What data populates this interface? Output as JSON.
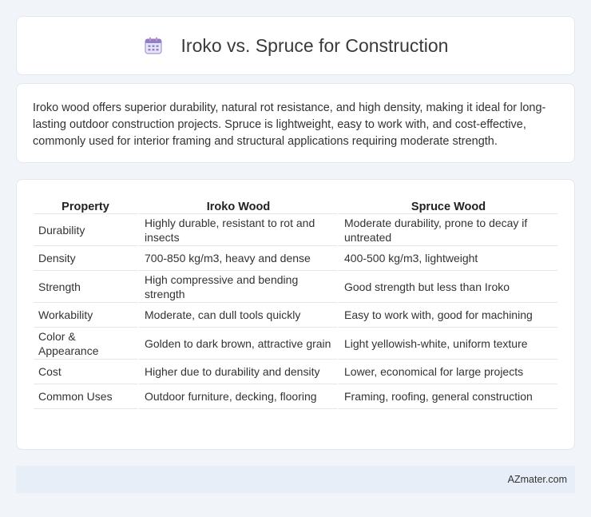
{
  "header": {
    "title": "Iroko vs. Spruce for Construction",
    "icon": "calendar-icon"
  },
  "intro": {
    "text": "Iroko wood offers superior durability, natural rot resistance, and high density, making it ideal for long-lasting outdoor construction projects. Spruce is lightweight, easy to work with, and cost-effective, commonly used for interior framing and structural applications requiring moderate strength."
  },
  "table": {
    "headers": [
      "Property",
      "Iroko Wood",
      "Spruce Wood"
    ],
    "rows": [
      {
        "property": "Durability",
        "iroko": "Highly durable, resistant to rot and insects",
        "spruce": "Moderate durability, prone to decay if untreated"
      },
      {
        "property": "Density",
        "iroko": "700-850 kg/m3, heavy and dense",
        "spruce": "400-500 kg/m3, lightweight"
      },
      {
        "property": "Strength",
        "iroko": "High compressive and bending strength",
        "spruce": "Good strength but less than Iroko"
      },
      {
        "property": "Workability",
        "iroko": "Moderate, can dull tools quickly",
        "spruce": "Easy to work with, good for machining"
      },
      {
        "property": "Color & Appearance",
        "iroko": "Golden to dark brown, attractive grain",
        "spruce": "Light yellowish-white, uniform texture"
      },
      {
        "property": "Cost",
        "iroko": "Higher due to durability and density",
        "spruce": "Lower, economical for large projects"
      },
      {
        "property": "Common Uses",
        "iroko": "Outdoor furniture, decking, flooring",
        "spruce": "Framing, roofing, general construction"
      }
    ]
  },
  "footer": {
    "site": "AZmater.com"
  }
}
